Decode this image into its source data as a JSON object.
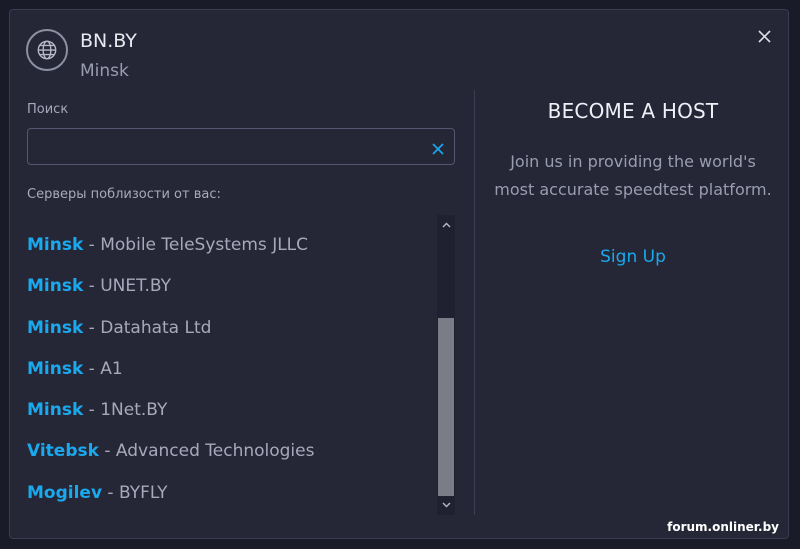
{
  "isp": {
    "name": "BN.BY",
    "city": "Minsk"
  },
  "search": {
    "label": "Поиск",
    "value": "",
    "placeholder": ""
  },
  "nearby_label": "Серверы поблизости от вас:",
  "servers": [
    {
      "city": "Minsk",
      "sep": " - ",
      "sponsor": "Mobile TeleSystems JLLC"
    },
    {
      "city": "Minsk",
      "sep": " - ",
      "sponsor": "UNET.BY"
    },
    {
      "city": "Minsk",
      "sep": " - ",
      "sponsor": "Datahata Ltd"
    },
    {
      "city": "Minsk",
      "sep": " - ",
      "sponsor": "A1"
    },
    {
      "city": "Minsk",
      "sep": " - ",
      "sponsor": "1Net.BY"
    },
    {
      "city": "Vitebsk",
      "sep": " - ",
      "sponsor": "Advanced Technologies"
    },
    {
      "city": "Mogilev",
      "sep": " - ",
      "sponsor": "BYFLY"
    }
  ],
  "host": {
    "title": "BECOME A HOST",
    "text": "Join us in providing the world's most accurate speedtest platform.",
    "signup": "Sign Up"
  },
  "watermark": "forum.onliner.by",
  "icons": {
    "globe": "globe-icon",
    "close": "close-icon",
    "clear": "clear-icon"
  },
  "colors": {
    "accent": "#1aa9ee",
    "background": "#262736"
  }
}
